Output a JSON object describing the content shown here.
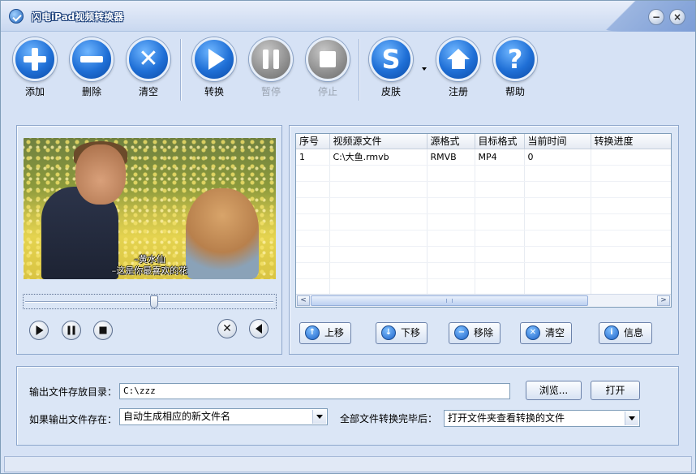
{
  "window": {
    "title": "闪电iPad视频转换器",
    "minimize_label": "−",
    "close_label": "×"
  },
  "toolbar": {
    "buttons": [
      {
        "label": "添加",
        "icon": "plus-icon",
        "enabled": true
      },
      {
        "label": "删除",
        "icon": "minus-icon",
        "enabled": true
      },
      {
        "label": "清空",
        "icon": "clear-icon",
        "enabled": true
      },
      {
        "label": "转换",
        "icon": "play-icon",
        "enabled": true
      },
      {
        "label": "暂停",
        "icon": "pause-icon",
        "enabled": false
      },
      {
        "label": "停止",
        "icon": "stop-icon",
        "enabled": false
      },
      {
        "label": "皮肤",
        "icon": "skin-icon",
        "enabled": true
      },
      {
        "label": "注册",
        "icon": "home-icon",
        "enabled": true
      },
      {
        "label": "帮助",
        "icon": "help-icon",
        "enabled": true
      }
    ],
    "skin_letter": "S",
    "help_glyph": "?",
    "clear_glyph": "✕"
  },
  "preview": {
    "subtitle_line1": "–黄水仙",
    "subtitle_line2": "–这是你最喜欢的花",
    "seek_position": 0.52
  },
  "file_table": {
    "columns": [
      "序号",
      "视频源文件",
      "源格式",
      "目标格式",
      "当前时间",
      "转换进度"
    ],
    "rows": [
      [
        "1",
        "C:\\大鱼.rmvb",
        "RMVB",
        "MP4",
        "0",
        ""
      ]
    ],
    "scroll_left": "<",
    "scroll_right": ">"
  },
  "list_actions": {
    "up": "上移",
    "down": "下移",
    "remove": "移除",
    "clear": "清空",
    "info": "信息"
  },
  "settings": {
    "output_dir_label": "输出文件存放目录：",
    "output_dir_value": "C:\\zzz",
    "browse": "浏览...",
    "open": "打开",
    "exists_label": "如果输出文件存在：",
    "exists_value": "自动生成相应的新文件名",
    "after_label": "全部文件转换完毕后：",
    "after_value": "打开文件夹查看转换的文件"
  },
  "colors": {
    "accent": "#1f6fd6",
    "window_bg": "#d6e2f5",
    "disabled_text": "#9aa3b0"
  }
}
